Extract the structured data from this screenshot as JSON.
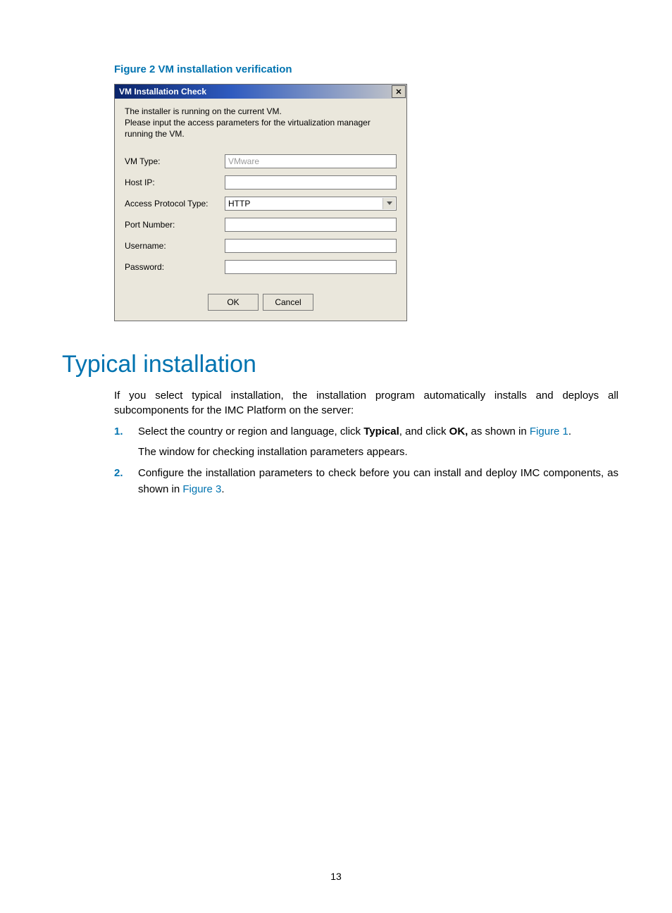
{
  "figure_caption": "Figure 2 VM installation verification",
  "dialog": {
    "title": "VM Installation Check",
    "intro_line1": "The installer is running on the current VM.",
    "intro_line2": "Please input the access parameters for the virtualization manager running the VM.",
    "labels": {
      "vm_type": "VM Type:",
      "host_ip": "Host IP:",
      "access_protocol": "Access Protocol Type:",
      "port_number": "Port Number:",
      "username": "Username:",
      "password": "Password:"
    },
    "values": {
      "vm_type": "VMware",
      "host_ip": "",
      "access_protocol": "HTTP",
      "port_number": "",
      "username": "",
      "password": ""
    },
    "buttons": {
      "ok": "OK",
      "cancel": "Cancel"
    }
  },
  "section_heading": "Typical installation",
  "intro_paragraph": "If you select typical installation, the installation program automatically installs and deploys all subcomponents for the IMC Platform on the server:",
  "steps": {
    "s1_pre": "Select the country or region and language, click ",
    "s1_bold1": "Typical",
    "s1_mid": ", and click ",
    "s1_bold2": "OK,",
    "s1_post": " as shown in ",
    "s1_link": "Figure 1",
    "s1_end": ".",
    "s1_sub": "The window for checking installation parameters appears.",
    "s2_pre": "Configure the installation parameters to check before you can install and deploy IMC components, as shown in ",
    "s2_link": "Figure 3",
    "s2_end": "."
  },
  "page_number": "13"
}
